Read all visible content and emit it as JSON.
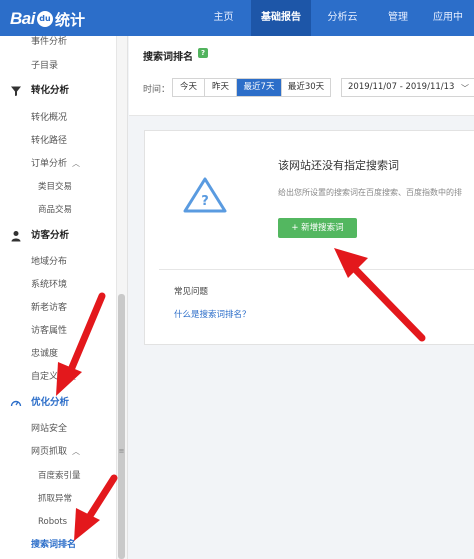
{
  "brand": {
    "logo_prefix": "Bai",
    "logo_paw": "du",
    "logo_suffix": "统计"
  },
  "nav": {
    "items": [
      {
        "label": "主页",
        "active": false
      },
      {
        "label": "基础报告",
        "active": true
      },
      {
        "label": "分析云",
        "active": false
      },
      {
        "label": "管理",
        "active": false
      },
      {
        "label": "应用中",
        "active": false
      }
    ]
  },
  "sidebar": {
    "partial_top": "事件分析",
    "subdir": "子目录",
    "conversion": {
      "label": "转化分析",
      "items": [
        "转化概况",
        "转化路径"
      ],
      "order": "订单分析",
      "order_items": [
        "类目交易",
        "商品交易"
      ]
    },
    "visitor": {
      "label": "访客分析",
      "items": [
        "地域分布",
        "系统环境",
        "新老访客",
        "访客属性",
        "忠诚度",
        "自定义变量"
      ]
    },
    "optimize": {
      "label": "优化分析",
      "items": [
        "网站安全"
      ],
      "crawl": "网页抓取",
      "crawl_items": [
        "百度索引量",
        "抓取异常",
        "Robots"
      ],
      "active_item": "搜索词排名"
    }
  },
  "header": {
    "title": "搜索词排名",
    "help_badge": "?",
    "time_label": "时间：",
    "ranges": [
      "今天",
      "昨天",
      "最近7天",
      "最近30天"
    ],
    "active_range": "最近7天",
    "date_range": "2019/11/07 - 2019/11/13"
  },
  "empty_state": {
    "title": "该网站还没有指定搜索词",
    "description": "给出您所设置的搜索词在百度搜索、百度指数中的排",
    "add_button": "+ 新增搜索词",
    "faq_title": "常见问题",
    "faq_link": "什么是搜索词排名？"
  },
  "colors": {
    "topbar": "#2c6ec9",
    "nav_active": "#1d56a8",
    "add_button": "#53b760",
    "arrow": "#e3181c",
    "warning_icon": "#5a9be0"
  }
}
